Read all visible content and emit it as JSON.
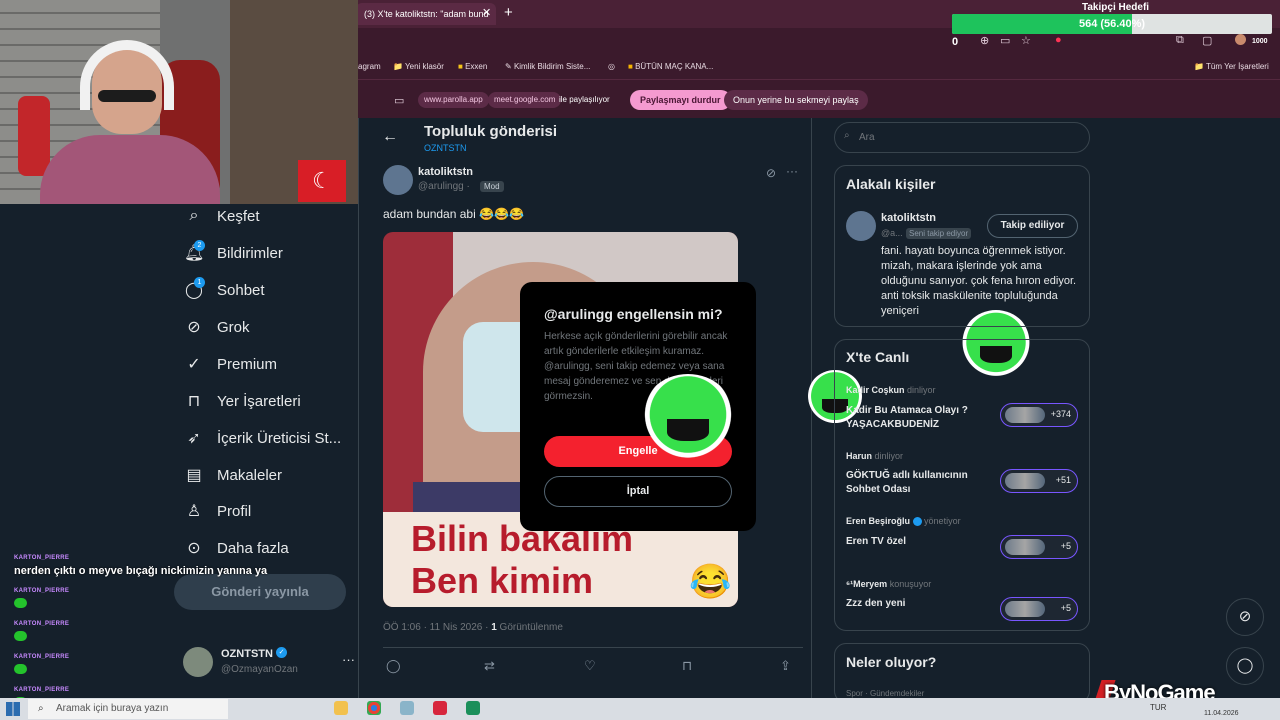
{
  "browser": {
    "tab_title": "(3) X'te katoliktstn: \"adam bund",
    "tab_close": "✕",
    "new_tab": "+",
    "bookmarks": [
      "agram",
      "Yeni klasör",
      "Exxen",
      "Kimlik Bildirim Siste...",
      "BÜTÜN MAÇ KANA...",
      "Tüm Yer İşaretleri"
    ],
    "share_sites": [
      "www.parolla.app",
      "meet.google.com"
    ],
    "share_text": "ile paylaşılıyor",
    "stop_sharing": "Paylaşmayı durdur",
    "share_this_tab": "Onun yerine bu sekmeyi paylaş"
  },
  "follower_goal": {
    "title": "Takipçi Hedefi",
    "value_text": "564 (56.40%)",
    "progress": 0.564,
    "min_label": "0",
    "max_label": "1000",
    "fill_color": "#1ec35c"
  },
  "nav": {
    "items": [
      {
        "label": "Keşfet",
        "icon": "search-icon"
      },
      {
        "label": "Bildirimler",
        "icon": "bell-icon",
        "badge": "2"
      },
      {
        "label": "Sohbet",
        "icon": "chat-icon",
        "badge": "1"
      },
      {
        "label": "Grok",
        "icon": "grok-icon"
      },
      {
        "label": "Premium",
        "icon": "premium-icon"
      },
      {
        "label": "Yer İşaretleri",
        "icon": "bookmark-icon"
      },
      {
        "label": "İçerik Üreticisi St...",
        "icon": "rocket-icon"
      },
      {
        "label": "Makaleler",
        "icon": "article-icon"
      },
      {
        "label": "Profil",
        "icon": "person-icon"
      },
      {
        "label": "Daha fazla",
        "icon": "more-icon"
      }
    ],
    "post_button": "Gönderi yayınla",
    "account": {
      "name": "OZNTSTN",
      "handle": "@OzmayanOzan",
      "more": "···"
    }
  },
  "chat": [
    {
      "user": "KARTON_PIERRE",
      "message": "nerden çıktı o meyve bıçağı nickimizin yanına ya"
    },
    {
      "user": "KARTON_PIERRE",
      "emote": "green-emote"
    },
    {
      "user": "KARTON_PIERRE",
      "emote": "green-emote"
    },
    {
      "user": "KARTON_PIERRE",
      "emote": "green-emote"
    },
    {
      "user": "KARTON_PIERRE",
      "emote": "green-emote"
    }
  ],
  "post_page": {
    "title": "Topluluk gönderisi",
    "community": "OZNTSTN",
    "author": {
      "name": "katoliktstn",
      "handle": "@arulingg ·",
      "badge": "Mod"
    },
    "text": "adam bundan abi 😂😂😂",
    "media": {
      "line1": "Bilin bakalım",
      "line2": "Ben kimim",
      "emoji": "😂"
    },
    "meta_time": "ÖÖ 1:06 · 11 Nis 2026 · ",
    "meta_views_count": "1",
    "meta_views_label": " Görüntülenme"
  },
  "modal": {
    "title": "@arulingg engellensin mi?",
    "body": "Herkese açık gönderilerini görebilir ancak artık gönderilerle etkileşim kuramaz. @arulingg, seni takip edemez veya sana mesaj gönderemez ve sen de bildirimleri görmezsin.",
    "confirm": "Engelle",
    "cancel": "İptal"
  },
  "right": {
    "search_placeholder": "Ara",
    "related": {
      "title": "Alakalı kişiler",
      "name": "katoliktstn",
      "handle": "@a...",
      "follows_you": "Seni takip ediyor",
      "follow_button": "Takip ediliyor",
      "bio": "fani. hayatı boyunca öğrenmek istiyor. mizah, makara işlerinde yok ama olduğunu sanıyor. çok fena hıron ediyor. anti toksik maskülenite topluluğunda yeniçeri"
    },
    "live": {
      "title": "X'te Canlı",
      "spaces": [
        {
          "host": "Kadir Coşkun",
          "status": "dinliyor",
          "title": "Kadir Bu Atamaca Olayı ? YAŞACAKBUDENİZ",
          "count": "+374"
        },
        {
          "host": "Harun",
          "status": "dinliyor",
          "title": "GÖKTUĞ adlı kullanıcının Sohbet Odası",
          "count": "+51"
        },
        {
          "host": "Eren Beşiroğlu",
          "status": "yönetiyor",
          "title": "Eren TV özel",
          "count": "+5"
        },
        {
          "host": "⁶¹Meryem",
          "status": "konuşuyor",
          "title": "Zzz den yeni",
          "count": "+5"
        }
      ]
    },
    "trends": {
      "title": "Neler oluyor?",
      "sub": "Spor · Gündemdekiler"
    }
  },
  "watermark": "ByNoGame",
  "taskbar": {
    "search_placeholder": "Aramak için buraya yazın",
    "lang": "TUR",
    "date": "11.04.2026"
  }
}
